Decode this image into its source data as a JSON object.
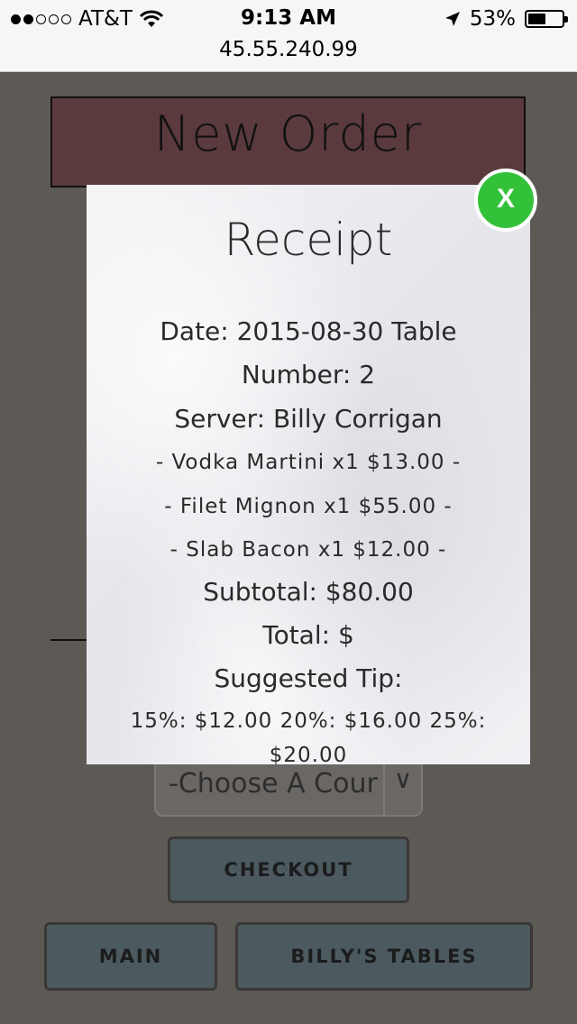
{
  "status_bar": {
    "carrier": "AT&T",
    "time": "9:13 AM",
    "url": "45.55.240.99",
    "battery": "53%",
    "battery_level": 0.53
  },
  "page": {
    "title": "New Order",
    "course_select": "-Choose A Cour",
    "checkout_label": "CHECKOUT",
    "main_label": "MAIN",
    "tables_label": "BILLY'S TABLES"
  },
  "receipt": {
    "title": "Receipt",
    "date_line": "Date: 2015-08-30 Table",
    "number_line": "Number: 2",
    "server_line": "Server: Billy Corrigan",
    "items": [
      "- Vodka Martini x1 $13.00 -",
      "- Filet Mignon x1 $55.00 -",
      "- Slab Bacon x1 $12.00 -"
    ],
    "subtotal": "Subtotal: $80.00",
    "total": "Total: $",
    "suggested_tip_label": "Suggested Tip:",
    "tip_line": "15%: $12.00 20%: $16.00 25%: $20.00",
    "close_label": "X"
  },
  "colors": {
    "background": "#5d5955",
    "header": "#5b3a3d",
    "button": "#4c5a60",
    "close": "#33c13a"
  }
}
